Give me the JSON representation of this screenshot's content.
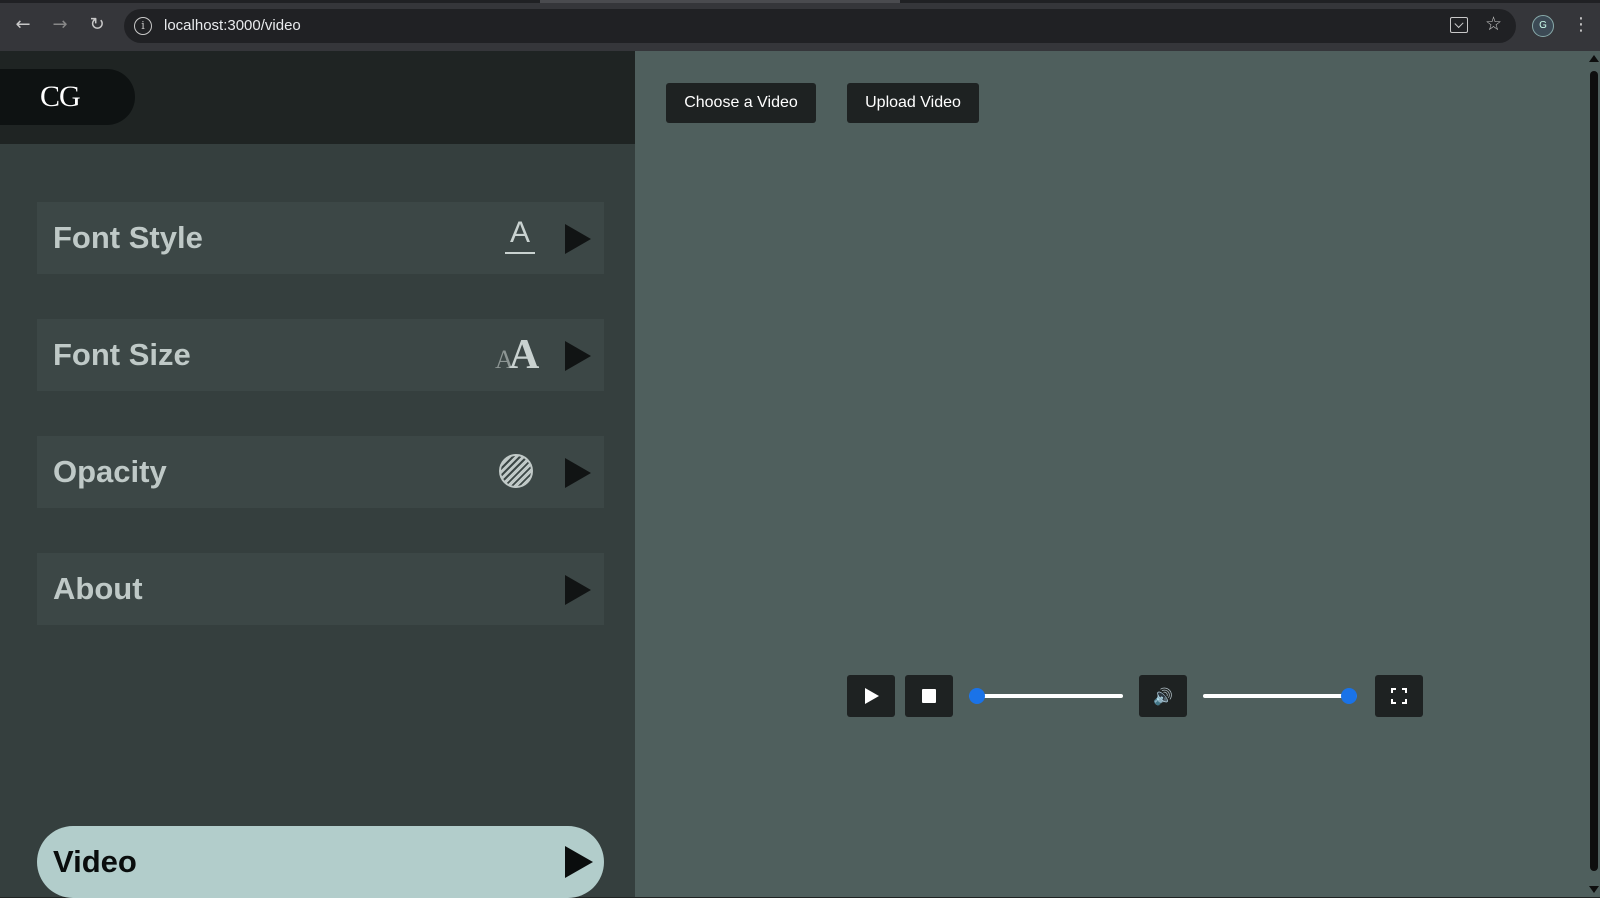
{
  "browser": {
    "url": "localhost:3000/video",
    "profile_initial": "G"
  },
  "sidebar": {
    "logo": "CG",
    "items": [
      {
        "label": "Font Style",
        "icon": "font-style-icon"
      },
      {
        "label": "Font Size",
        "icon": "font-size-icon"
      },
      {
        "label": "Opacity",
        "icon": "opacity-icon"
      },
      {
        "label": "About",
        "icon": ""
      }
    ],
    "active_item": {
      "label": "Video"
    }
  },
  "main": {
    "choose_label": "Choose a Video",
    "upload_label": "Upload Video",
    "player": {
      "progress": 0.0,
      "volume": 1.0
    }
  },
  "colors": {
    "sidebar_bg": "#353f3e",
    "main_bg": "#4f5f5d",
    "active_item_bg": "#b2cdcb",
    "accent": "#1a73e8"
  }
}
